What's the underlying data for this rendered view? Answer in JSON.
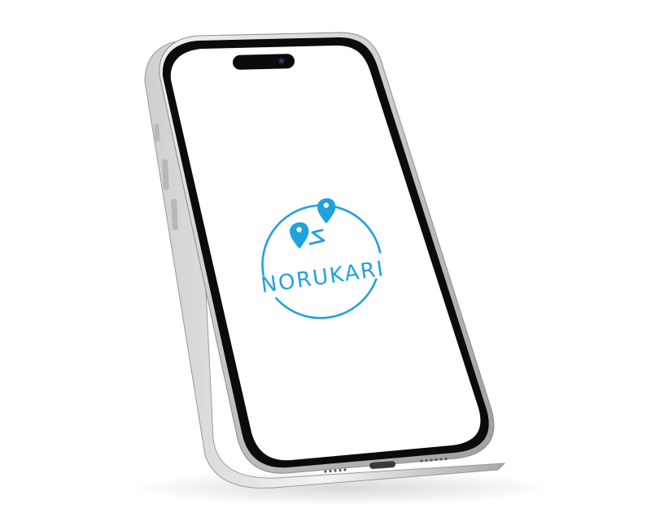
{
  "app": {
    "brand_name": "NORUKARI"
  },
  "colors": {
    "accent": "#1fa2de",
    "screen": "#ffffff",
    "bezel": "#0b0b0b",
    "frame": "#d9d9d9"
  },
  "icons": {
    "logo": "route-pins-icon",
    "camera": "camera-icon",
    "port": "usb-c-port-icon"
  }
}
